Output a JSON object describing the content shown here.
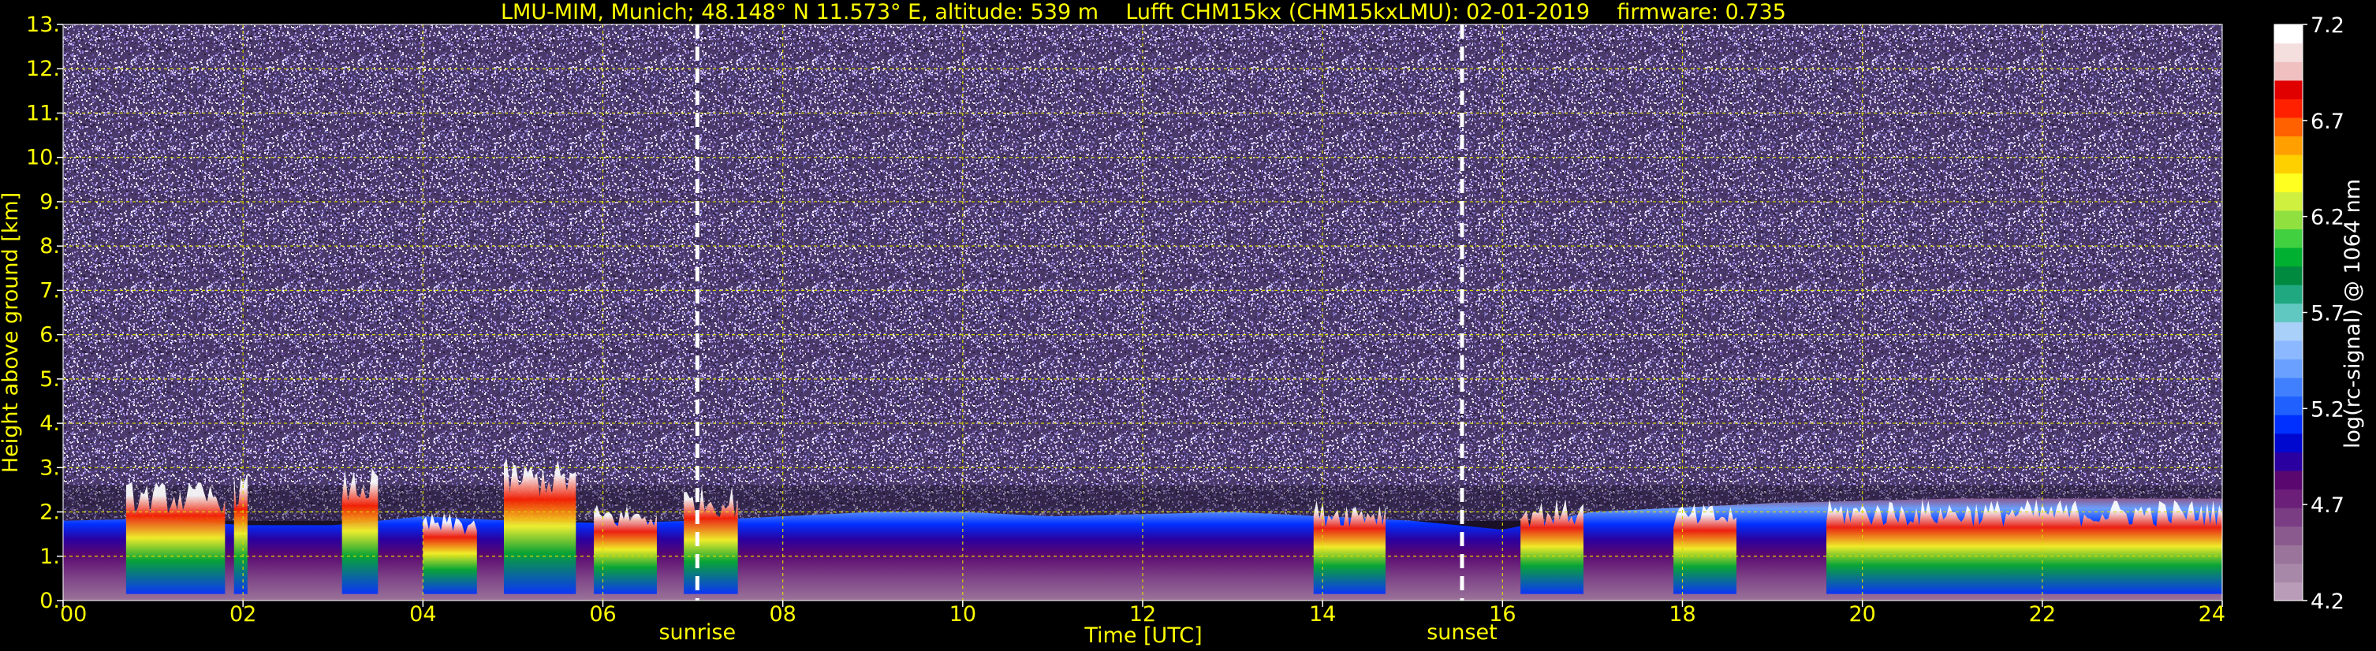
{
  "chart_data": {
    "type": "heatmap",
    "title": "LMU-MIM, Munich; 48.148° N 11.573° E, altitude: 539 m    Lufft CHM15kx (CHM15kxLMU): 02-01-2019    firmware: 0.735",
    "xlabel": "Time [UTC]",
    "ylabel": "Height above ground [km]",
    "xlim": [
      0,
      24
    ],
    "ylim": [
      0,
      13
    ],
    "x_ticks": [
      "00",
      "02",
      "04",
      "06",
      "08",
      "10",
      "12",
      "14",
      "16",
      "18",
      "20",
      "22",
      "24"
    ],
    "y_ticks": [
      "0.",
      "1.",
      "2.",
      "3.",
      "4.",
      "5.",
      "6.",
      "7.",
      "8.",
      "9.",
      "10.",
      "11.",
      "12.",
      "13."
    ],
    "grid": true,
    "events": [
      {
        "label": "sunrise",
        "time": 7.05
      },
      {
        "label": "sunset",
        "time": 15.55
      }
    ],
    "colorbar": {
      "label": "log(rc-signal) @ 1064 nm",
      "min": 4.2,
      "max": 7.2,
      "ticks": [
        "4.2",
        "4.7",
        "5.2",
        "5.7",
        "6.2",
        "6.7",
        "7.2"
      ],
      "colors": [
        "#b89cb8",
        "#a888a8",
        "#9a749a",
        "#8a5a8e",
        "#7a3d84",
        "#6c1f78",
        "#5a0870",
        "#2a00a0",
        "#0008d0",
        "#0030ff",
        "#2060ff",
        "#4080ff",
        "#6aa0ff",
        "#8cb8ff",
        "#a8d0f8",
        "#60c8c0",
        "#20a880",
        "#008a40",
        "#00b030",
        "#40d040",
        "#90e040",
        "#d0f040",
        "#ffff20",
        "#ffd000",
        "#ffa000",
        "#ff6000",
        "#ff2000",
        "#e00000",
        "#f0c0c0",
        "#f4dede",
        "#ffffff"
      ]
    },
    "layers": {
      "noise_colors": [
        "#ffffff",
        "#c8b4e6",
        "#8c78c8",
        "#6e64b4",
        "#5a3c8c",
        "#a08cdc",
        "#3c285a",
        "#d2c8f0",
        "#281e3c",
        "#b4a0ff"
      ],
      "boundary_layer_top_km": [
        1.8,
        1.85,
        1.7,
        1.7,
        1.9,
        1.8,
        1.75,
        1.8,
        1.9,
        2.0,
        2.0,
        1.9,
        1.95,
        2.0,
        1.9,
        1.8,
        1.6,
        2.0,
        2.1,
        2.2,
        2.25,
        2.3,
        2.3,
        2.3,
        2.3
      ],
      "cloud_segments": [
        {
          "start": 0.7,
          "end": 1.8,
          "top_km": 2.7
        },
        {
          "start": 1.9,
          "end": 2.05,
          "top_km": 2.9
        },
        {
          "start": 3.1,
          "end": 3.5,
          "top_km": 3.0
        },
        {
          "start": 4.0,
          "end": 4.6,
          "top_km": 2.0
        },
        {
          "start": 4.9,
          "end": 5.7,
          "top_km": 3.2
        },
        {
          "start": 5.9,
          "end": 6.6,
          "top_km": 2.2
        },
        {
          "start": 6.9,
          "end": 7.5,
          "top_km": 2.6
        },
        {
          "start": 13.9,
          "end": 14.7,
          "top_km": 2.3
        },
        {
          "start": 16.2,
          "end": 16.9,
          "top_km": 2.3
        },
        {
          "start": 17.9,
          "end": 18.6,
          "top_km": 2.2
        },
        {
          "start": 19.6,
          "end": 24.0,
          "top_km": 2.3
        }
      ]
    }
  }
}
